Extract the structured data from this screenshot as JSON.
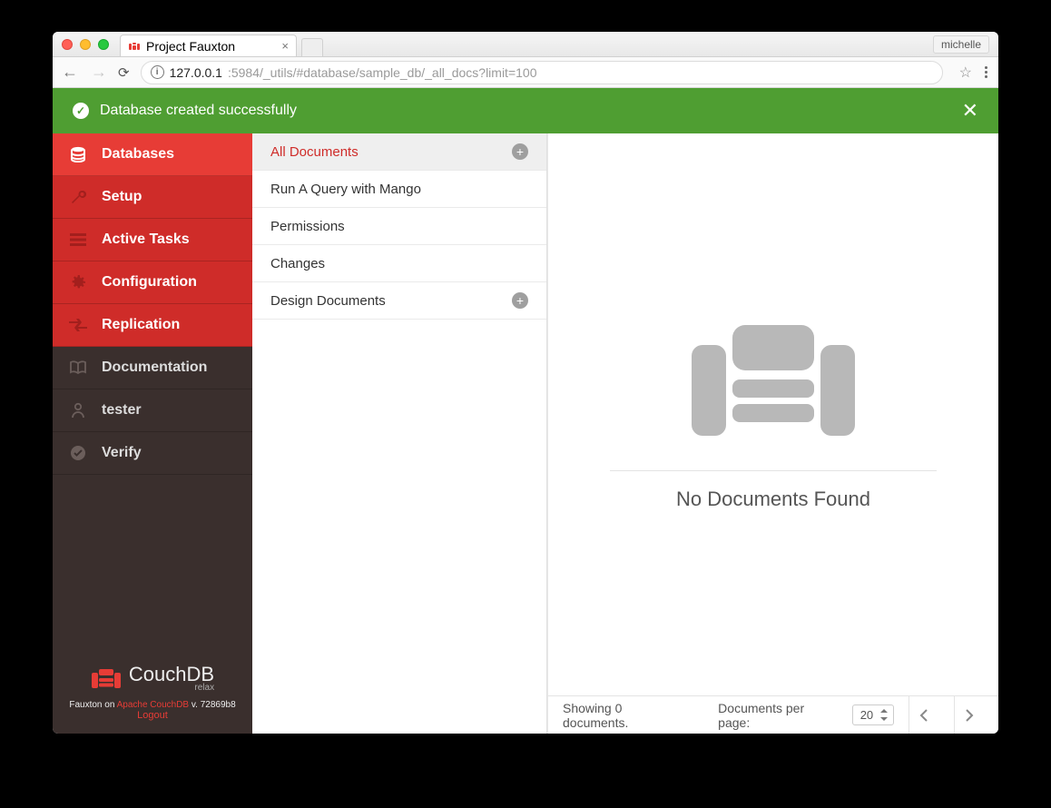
{
  "browser": {
    "tab_title": "Project Fauxton",
    "user": "michelle",
    "url_host": "127.0.0.1",
    "url_rest": ":5984/_utils/#database/sample_db/_all_docs?limit=100"
  },
  "notification": {
    "message": "Database created successfully"
  },
  "sidebar": {
    "items": [
      {
        "label": "Databases"
      },
      {
        "label": "Setup"
      },
      {
        "label": "Active Tasks"
      },
      {
        "label": "Configuration"
      },
      {
        "label": "Replication"
      },
      {
        "label": "Documentation"
      },
      {
        "label": "tester"
      },
      {
        "label": "Verify"
      }
    ],
    "footer": {
      "brand": "CouchDB",
      "tagline": "relax",
      "prefix": "Fauxton on ",
      "link": "Apache CouchDB",
      "version": " v. 72869b8",
      "logout": "Logout"
    }
  },
  "subnav": {
    "items": [
      {
        "label": "All Documents"
      },
      {
        "label": "Run A Query with Mango"
      },
      {
        "label": "Permissions"
      },
      {
        "label": "Changes"
      },
      {
        "label": "Design Documents"
      }
    ]
  },
  "main": {
    "empty_title": "No Documents Found",
    "showing": "Showing 0 documents.",
    "per_page_label": "Documents per page:",
    "per_page_value": "20"
  }
}
